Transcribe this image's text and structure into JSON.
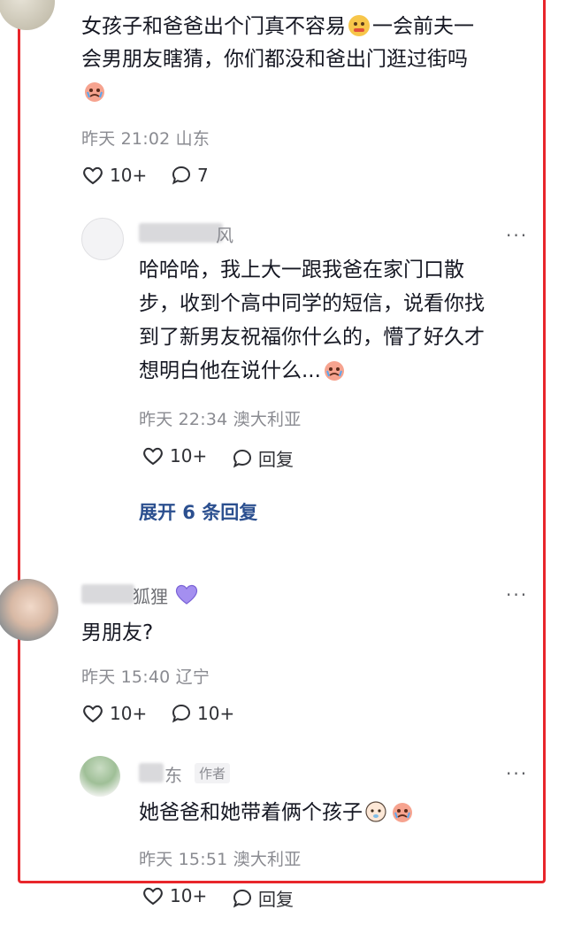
{
  "colors": {
    "frame": "#e8262b",
    "meta": "#8a8b91",
    "expand": "#2b4f8f",
    "heart_purple": "#8e7ce0"
  },
  "comment1": {
    "text_line1": "女孩子和爸爸出个门真不容易",
    "text_line1b": "一会前夫一",
    "text_line2": "会男朋友瞎猜，你们都没和爸出门逛过街吗",
    "time": "昨天 21:02",
    "location": "山东",
    "likes": "10+",
    "comments": "7",
    "emojis": [
      "grimace-emoji",
      "crying-emoji"
    ]
  },
  "reply1": {
    "username_visible": "风",
    "text_line1": "哈哈哈，我上大一跟我爸在家门口散",
    "text_line2": "步，收到个高中同学的短信，说看你找",
    "text_line3": "到了新男友祝福你什么的，懵了好久才",
    "text_line4": "想明白他在说什么...",
    "time": "昨天 22:34",
    "location": "澳大利亚",
    "likes": "10+",
    "reply_label": "回复",
    "more": "···"
  },
  "expand_label": "展开 6 条回复",
  "comment2": {
    "username_visible": "狐狸",
    "text": "男朋友?",
    "time": "昨天 15:40",
    "location": "辽宁",
    "likes": "10+",
    "comments": "10+",
    "more": "···"
  },
  "reply2": {
    "username_visible": "东",
    "author_tag": "作者",
    "text": "她爸爸和她带着俩个孩子",
    "time": "昨天 15:51",
    "location": "澳大利亚",
    "likes": "10+",
    "reply_label": "回复",
    "more": "···"
  }
}
